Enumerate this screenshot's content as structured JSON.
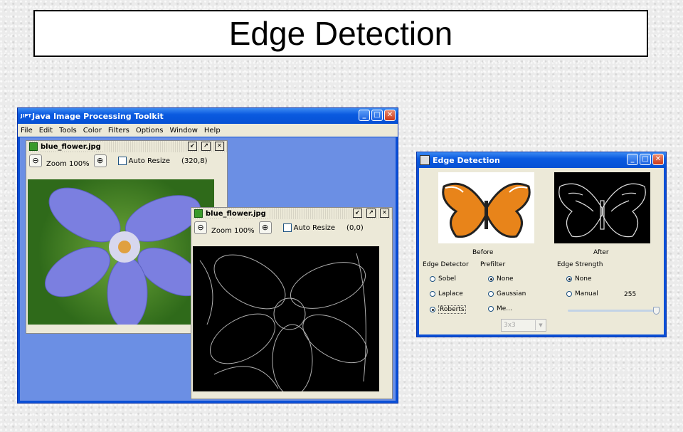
{
  "slide": {
    "title": "Edge Detection"
  },
  "main_window": {
    "app_icon": "JIPT",
    "title": "Java Image Processing Toolkit",
    "menu": [
      "File",
      "Edit",
      "Tools",
      "Color",
      "Filters",
      "Options",
      "Window",
      "Help"
    ]
  },
  "frame1": {
    "filename": "blue_flower.jpg",
    "zoom_label": "Zoom 100%",
    "auto_resize_label": "Auto Resize",
    "coords": "(320,8)"
  },
  "frame2": {
    "filename": "blue_flower.jpg",
    "zoom_label": "Zoom 100%",
    "auto_resize_label": "Auto Resize",
    "coords": "(0,0)"
  },
  "dialog": {
    "title": "Edge Detection",
    "before_label": "Before",
    "after_label": "After",
    "edge_detector": {
      "heading": "Edge Detector",
      "options": [
        "Sobel",
        "Laplace",
        "Roberts"
      ],
      "selected": "Roberts"
    },
    "prefilter": {
      "heading": "Prefilter",
      "options": [
        "None",
        "Gaussian",
        "Me..."
      ],
      "selected": "None",
      "size_select": "3x3"
    },
    "edge_strength": {
      "heading": "Edge Strength",
      "options": [
        "None",
        "Manual"
      ],
      "selected": "None",
      "value": "255",
      "slider_fraction": 1.0
    }
  }
}
